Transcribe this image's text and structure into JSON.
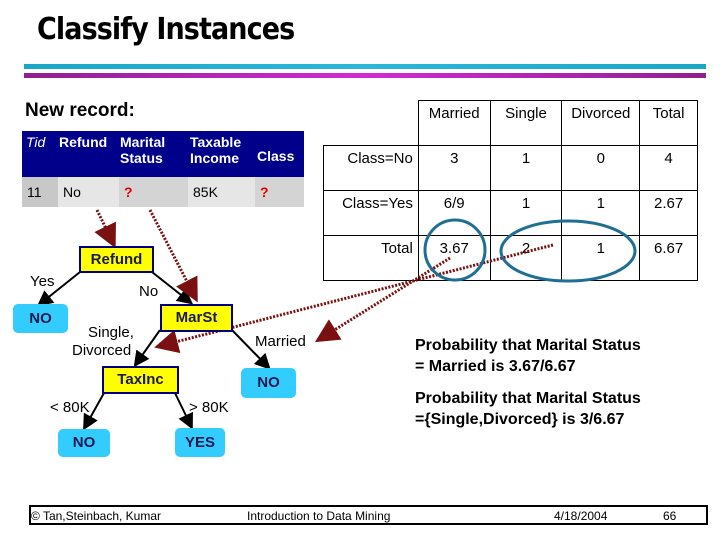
{
  "title": "Classify Instances",
  "new_record": {
    "label": "New record:",
    "headers": {
      "tid": "Tid",
      "refund": "Refund",
      "marital_1": "Marital",
      "marital_2": "Status",
      "taxable_1": "Taxable",
      "taxable_2": "Income",
      "class": "Class"
    },
    "row": {
      "tid": "11",
      "refund": "No",
      "marital": "?",
      "income": "85K",
      "class": "?"
    },
    "colors": {
      "header_bg": "#00008b",
      "row_bg": "#d4d4d4",
      "unknown": "#e00000"
    }
  },
  "count_table": {
    "headers": [
      "",
      "Married",
      "Single",
      "Divorced",
      "Total"
    ],
    "rows": [
      {
        "label": "Class=No",
        "values": [
          "3",
          "1",
          "0",
          "4"
        ]
      },
      {
        "label": "Class=Yes",
        "values": [
          "6/9",
          "1",
          "1",
          "2.67"
        ]
      },
      {
        "label": "Total",
        "values": [
          "3.67",
          "2",
          "1",
          "6.67"
        ]
      }
    ]
  },
  "tree": {
    "nodes": {
      "refund": "Refund",
      "marst": "MarSt",
      "taxinc": "TaxInc",
      "leaf_refund_yes": "NO",
      "leaf_married": "NO",
      "leaf_low_income": "NO",
      "leaf_high_income": "YES"
    },
    "edges": {
      "yes": "Yes",
      "no": "No",
      "single_divorced_1": "Single,",
      "single_divorced_2": "Divorced",
      "married": "Married",
      "lt_80k": "< 80K",
      "gt_80k": "> 80K"
    },
    "colors": {
      "decision_fill": "#ffff00",
      "leaf_fill": "#33ccff",
      "arrow": "#7a1010",
      "highlight": "#1f6f94"
    }
  },
  "probabilities": [
    {
      "line1": "Probability that Marital Status",
      "line2": "= Married is 3.67/6.67"
    },
    {
      "line1": "Probability that Marital Status",
      "line2": "={Single,Divorced} is 3/6.67"
    }
  ],
  "footer": {
    "copyright": "© Tan,Steinbach, Kumar",
    "course": "Introduction to Data Mining",
    "date": "4/18/2004",
    "page": "66"
  }
}
